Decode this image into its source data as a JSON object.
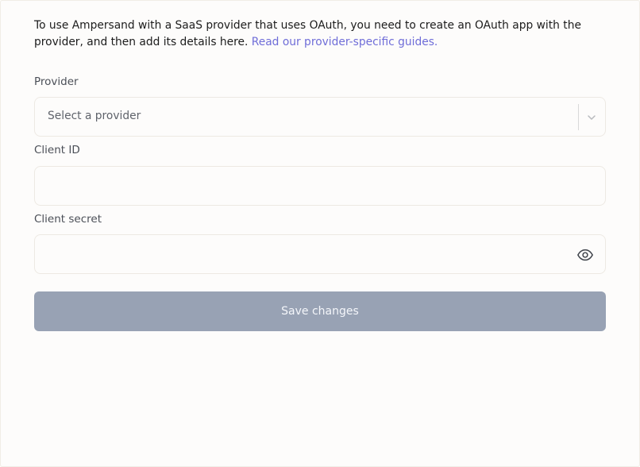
{
  "intro": {
    "text": "To use Ampersand with a SaaS provider that uses OAuth, you need to create an OAuth app with the provider, and then add its details here.",
    "link_text": "Read our provider-specific guides."
  },
  "provider": {
    "label": "Provider",
    "placeholder": "Select a provider"
  },
  "client_id": {
    "label": "Client ID",
    "value": ""
  },
  "client_secret": {
    "label": "Client secret",
    "value": ""
  },
  "save_button": {
    "label": "Save changes",
    "state": "disabled"
  },
  "colors": {
    "link": "#6f6dd8",
    "button_disabled": "#98a2b4",
    "field_border": "#ede9e3"
  },
  "icons": {
    "select_chevron": "chevron-down-icon",
    "secret_visibility": "eye-icon"
  }
}
